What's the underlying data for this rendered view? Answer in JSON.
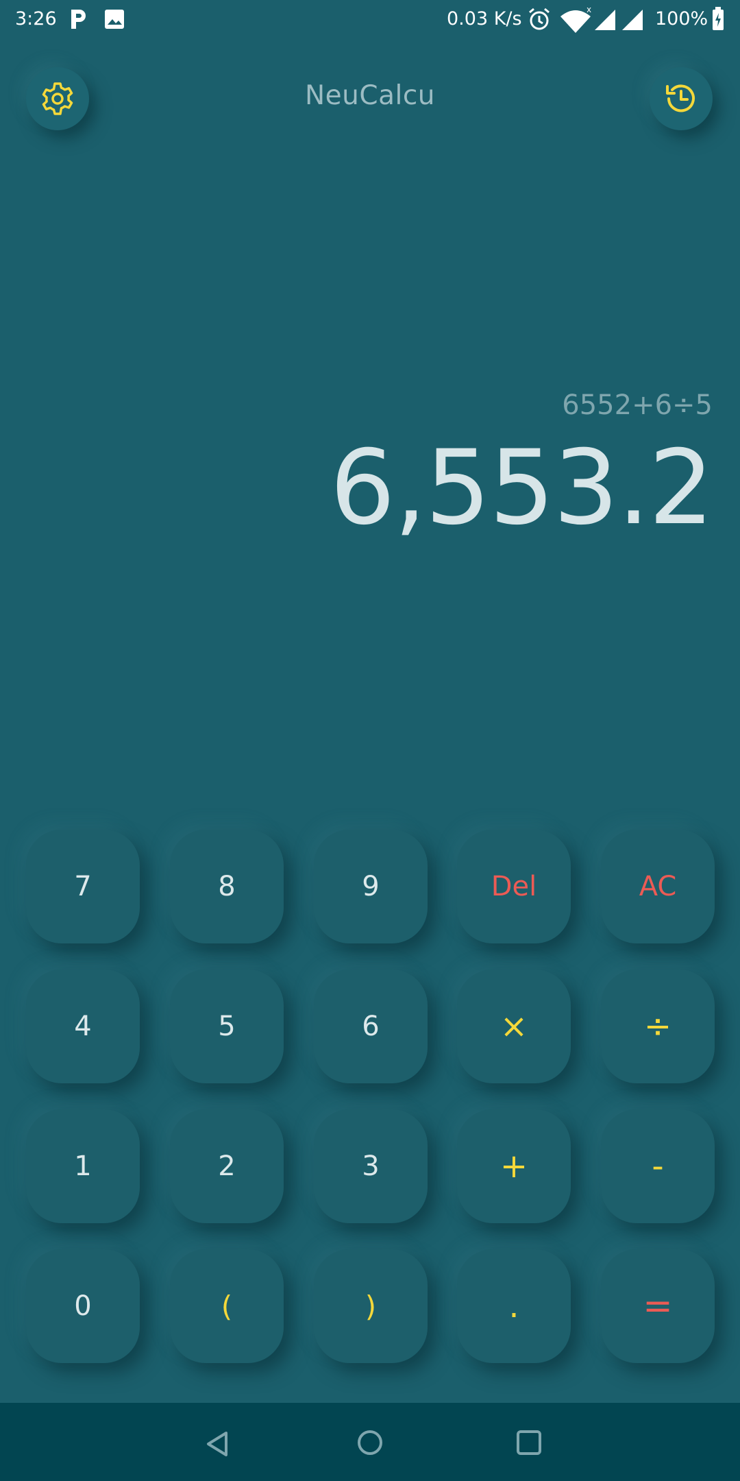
{
  "status_bar": {
    "time": "3:26",
    "network_speed": "0.03 K/s",
    "battery": "100%",
    "icons": [
      "parking-icon",
      "image-icon",
      "alarm-icon",
      "wifi-icon",
      "signal-icon",
      "signal-icon",
      "battery-charging-icon"
    ]
  },
  "header": {
    "title": "NeuCalcu",
    "settings_icon": "gear-icon",
    "history_icon": "history-icon"
  },
  "display": {
    "expression": "6552+6÷5",
    "result": "6,553.2"
  },
  "keypad": {
    "rows": [
      [
        "7",
        "8",
        "9",
        "Del",
        "AC"
      ],
      [
        "4",
        "5",
        "6",
        "×",
        "÷"
      ],
      [
        "1",
        "2",
        "3",
        "+",
        "-"
      ],
      [
        "0",
        "(",
        ")",
        ".",
        "="
      ]
    ]
  },
  "colors": {
    "background": "#1b5f6c",
    "accent_yellow": "#f4d83a",
    "accent_red": "#ec5b55",
    "text_light": "#d7e5e8",
    "nav_bar": "#024551"
  },
  "nav_bar": {
    "icons": [
      "back-icon",
      "home-icon",
      "recents-icon"
    ]
  }
}
